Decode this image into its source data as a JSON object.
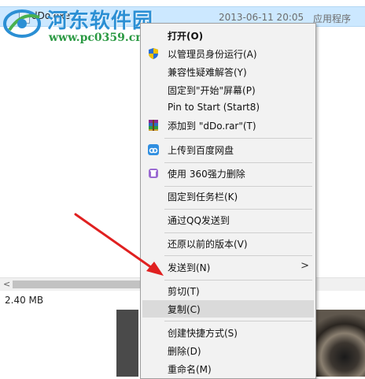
{
  "file": {
    "name": "dDo.exe",
    "date": "2013-06-11 20:05",
    "type": "应用程序"
  },
  "watermark": {
    "title": "河东软件园",
    "url": "www.pc0359.cn"
  },
  "status": {
    "size": "2.40 MB"
  },
  "scrollbar": {
    "left_arrow": "<"
  },
  "context_menu": {
    "items": [
      {
        "label": "打开(O)",
        "icon": "none"
      },
      {
        "label": "以管理员身份运行(A)",
        "icon": "uac-shield-icon"
      },
      {
        "label": "兼容性疑难解答(Y)",
        "icon": "none"
      },
      {
        "label": "固定到\"开始\"屏幕(P)",
        "icon": "none"
      },
      {
        "label": "Pin to Start (Start8)",
        "icon": "none"
      },
      {
        "label": "添加到 \"dDo.rar\"(T)",
        "icon": "winrar-icon"
      },
      {
        "label": "上传到百度网盘",
        "icon": "baidu-cloud-icon"
      },
      {
        "label": "使用 360强力删除",
        "icon": "360-delete-icon"
      },
      {
        "label": "固定到任务栏(K)",
        "icon": "none"
      },
      {
        "label": "通过QQ发送到",
        "icon": "none"
      },
      {
        "label": "还原以前的版本(V)",
        "icon": "none"
      },
      {
        "label": "发送到(N)",
        "icon": "none",
        "submenu_arrow": ">"
      },
      {
        "label": "剪切(T)",
        "icon": "none"
      },
      {
        "label": "复制(C)",
        "icon": "none",
        "highlighted": true
      },
      {
        "label": "创建快捷方式(S)",
        "icon": "none"
      },
      {
        "label": "删除(D)",
        "icon": "none"
      },
      {
        "label": "重命名(M)",
        "icon": "none"
      }
    ]
  },
  "colors": {
    "selection": "#cce8ff",
    "menu_bg": "#f2f2f2",
    "menu_highlight": "#dadada",
    "arrow": "#e02020",
    "watermark_blue": "#2b8fd4",
    "watermark_green": "#2c9a44"
  }
}
